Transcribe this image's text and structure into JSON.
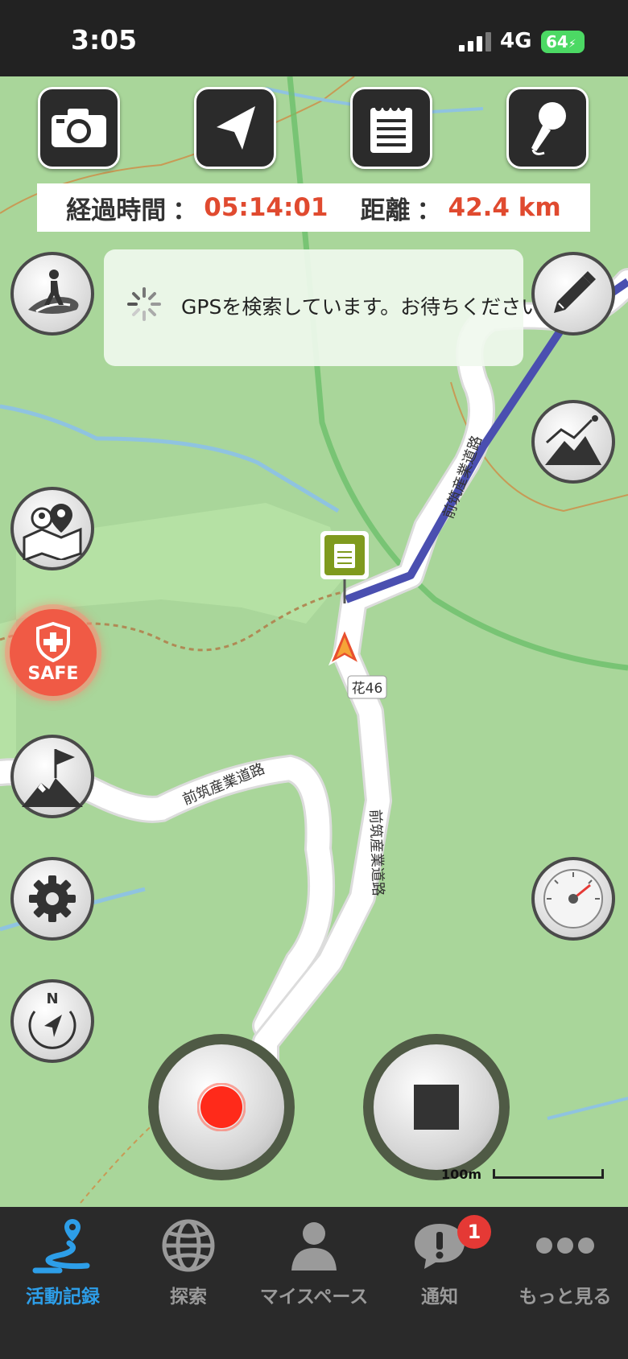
{
  "status_bar": {
    "time": "3:05",
    "network": "4G",
    "battery": "64"
  },
  "toolbar": {
    "items": [
      {
        "icon": "camera-icon"
      },
      {
        "icon": "navigation-arrow-icon"
      },
      {
        "icon": "notepad-icon"
      },
      {
        "icon": "microphone-icon"
      }
    ]
  },
  "stats": {
    "elapsed_label": "経過時間",
    "elapsed_value": "05:14:01",
    "distance_label": "距離",
    "distance_value": "42.4 km",
    "separator": "："
  },
  "gps_toast": {
    "message": "GPSを検索しています。お待ちください"
  },
  "map": {
    "road_labels": [
      "前筑産業道路",
      "前筑産業道路",
      "前筑産業道路"
    ],
    "route_number": "花46",
    "scale": "100m"
  },
  "safe_button": {
    "label": "SAFE"
  },
  "tabs": [
    {
      "label": "活動記録",
      "icon": "activity-route-icon"
    },
    {
      "label": "探索",
      "icon": "globe-icon"
    },
    {
      "label": "マイスペース",
      "icon": "person-icon"
    },
    {
      "label": "通知",
      "icon": "notification-icon"
    },
    {
      "label": "もっと見る",
      "icon": "more-dots-icon"
    }
  ],
  "notification_count": "1",
  "colors": {
    "accent": "#2d9ee8",
    "stat_value": "#e04a2f",
    "route": "#4a4fb0",
    "record": "#ff2a1a",
    "map_bg": "#a9d69a"
  }
}
